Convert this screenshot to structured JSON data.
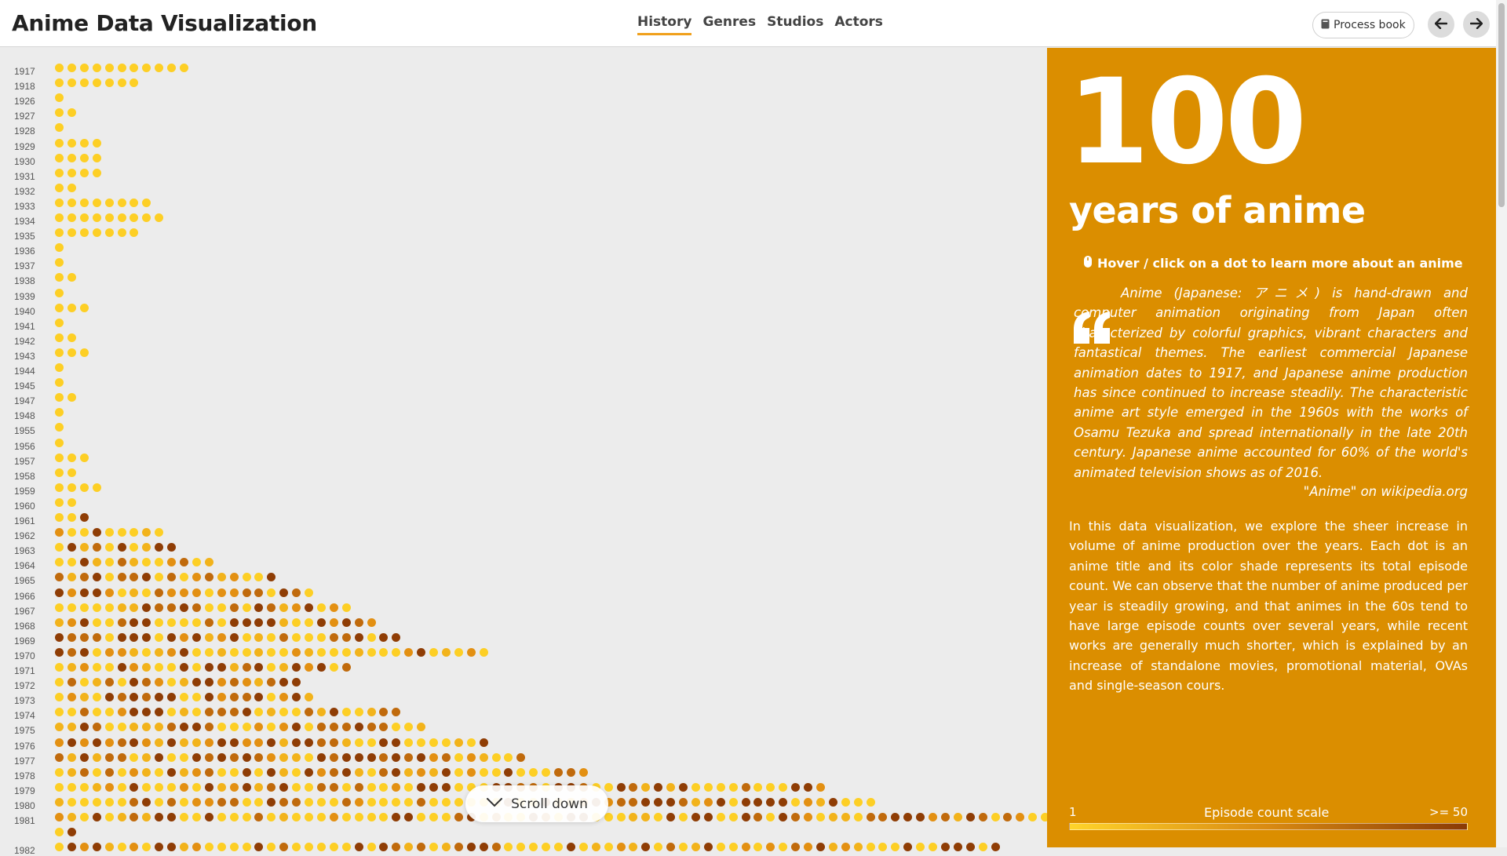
{
  "app": {
    "title": "Anime Data Visualization",
    "tabs": [
      {
        "label": "History",
        "active": true
      },
      {
        "label": "Genres",
        "active": false
      },
      {
        "label": "Studios",
        "active": false
      },
      {
        "label": "Actors",
        "active": false
      }
    ],
    "process_book_label": "Process book",
    "prev_icon": "arrow-left-icon",
    "next_icon": "arrow-right-icon"
  },
  "viz": {
    "scroll_label": "Scroll down",
    "colors": {
      "low": "#fdcf25",
      "mid_low": "#f2b31b",
      "mid": "#e39012",
      "high": "#c06a0c",
      "max": "#8f3d05"
    },
    "rows": [
      {
        "year": "1917",
        "count": 11,
        "darkness": 0.0
      },
      {
        "year": "1918",
        "count": 7,
        "darkness": 0.0
      },
      {
        "year": "1926",
        "count": 1,
        "darkness": 0.0
      },
      {
        "year": "1927",
        "count": 2,
        "darkness": 0.0
      },
      {
        "year": "1928",
        "count": 1,
        "darkness": 0.0
      },
      {
        "year": "1929",
        "count": 4,
        "darkness": 0.0
      },
      {
        "year": "1930",
        "count": 4,
        "darkness": 0.0
      },
      {
        "year": "1931",
        "count": 4,
        "darkness": 0.0
      },
      {
        "year": "1932",
        "count": 2,
        "darkness": 0.0
      },
      {
        "year": "1933",
        "count": 8,
        "darkness": 0.0
      },
      {
        "year": "1934",
        "count": 9,
        "darkness": 0.0
      },
      {
        "year": "1935",
        "count": 7,
        "darkness": 0.0
      },
      {
        "year": "1936",
        "count": 1,
        "darkness": 0.0
      },
      {
        "year": "1937",
        "count": 1,
        "darkness": 0.0
      },
      {
        "year": "1938",
        "count": 2,
        "darkness": 0.0
      },
      {
        "year": "1939",
        "count": 1,
        "darkness": 0.0
      },
      {
        "year": "1940",
        "count": 3,
        "darkness": 0.0
      },
      {
        "year": "1941",
        "count": 1,
        "darkness": 0.0
      },
      {
        "year": "1942",
        "count": 2,
        "darkness": 0.0
      },
      {
        "year": "1943",
        "count": 3,
        "darkness": 0.0
      },
      {
        "year": "1944",
        "count": 1,
        "darkness": 0.0
      },
      {
        "year": "1945",
        "count": 1,
        "darkness": 0.0
      },
      {
        "year": "1947",
        "count": 2,
        "darkness": 0.0
      },
      {
        "year": "1948",
        "count": 1,
        "darkness": 0.0
      },
      {
        "year": "1955",
        "count": 1,
        "darkness": 0.0
      },
      {
        "year": "1956",
        "count": 1,
        "darkness": 0.0
      },
      {
        "year": "1957",
        "count": 3,
        "darkness": 0.0
      },
      {
        "year": "1958",
        "count": 2,
        "darkness": 0.0
      },
      {
        "year": "1959",
        "count": 4,
        "darkness": 0.0
      },
      {
        "year": "1960",
        "count": 2,
        "darkness": 0.0
      },
      {
        "year": "1961",
        "count": 3,
        "darkness": 0.3
      },
      {
        "year": "1962",
        "count": 9,
        "darkness": 0.25
      },
      {
        "year": "1963",
        "count": 10,
        "darkness": 0.4
      },
      {
        "year": "1964",
        "count": 13,
        "darkness": 0.3
      },
      {
        "year": "1965",
        "count": 18,
        "darkness": 0.5
      },
      {
        "year": "1966",
        "count": 21,
        "darkness": 0.5
      },
      {
        "year": "1967",
        "count": 24,
        "darkness": 0.5
      },
      {
        "year": "1968",
        "count": 26,
        "darkness": 0.5
      },
      {
        "year": "1969",
        "count": 28,
        "darkness": 0.45
      },
      {
        "year": "1970",
        "count": 35,
        "darkness": 0.45
      },
      {
        "year": "1971",
        "count": 24,
        "darkness": 0.45
      },
      {
        "year": "1972",
        "count": 20,
        "darkness": 0.5
      },
      {
        "year": "1973",
        "count": 21,
        "darkness": 0.55
      },
      {
        "year": "1974",
        "count": 28,
        "darkness": 0.5
      },
      {
        "year": "1975",
        "count": 30,
        "darkness": 0.5
      },
      {
        "year": "1976",
        "count": 35,
        "darkness": 0.55
      },
      {
        "year": "1977",
        "count": 38,
        "darkness": 0.5
      },
      {
        "year": "1978",
        "count": 43,
        "darkness": 0.45
      },
      {
        "year": "1979",
        "count": 62,
        "darkness": 0.4
      },
      {
        "year": "1980",
        "count": 66,
        "darkness": 0.4
      },
      {
        "year": "1981",
        "count": 82,
        "darkness": 0.45
      },
      {
        "year": "",
        "count": 2,
        "darkness": 0.2
      },
      {
        "year": "1982",
        "count": 76,
        "darkness": 0.45
      }
    ]
  },
  "panel": {
    "big_number": "100",
    "big_subtitle": "years of anime",
    "hint": "Hover / click on a dot to learn more about an anime",
    "hint_icon": "mouse-icon",
    "quote_icon": "quote-icon",
    "quote": "Anime (Japanese: アニメ) is hand-drawn and computer animation originating from Japan often characterized by colorful graphics, vibrant characters and fantastical themes. The earliest commercial Japanese animation dates to 1917, and Japanese anime production has since continued to increase steadily. The characteristic anime art style emerged in the 1960s with the works of Osamu Tezuka and spread internationally in the late 20th century. Japanese anime accounted for 60% of the world's animated television shows as of 2016.",
    "quote_source": "\"Anime\" on wikipedia.org",
    "intro": "In this data visualization, we explore the sheer increase in volume of anime production over the years. Each dot is an anime title and its color shade represents its total episode count. We can observe that the number of anime produced per year is steadily growing, and that animes in the 60s tend to have large episode counts over several years, while recent works are generally much shorter, which is explained by an increase of standalone movies, promotional material, OVAs and single-season cours.",
    "scale": {
      "min_label": "1",
      "title": "Episode count scale",
      "max_label": ">= 50"
    }
  }
}
